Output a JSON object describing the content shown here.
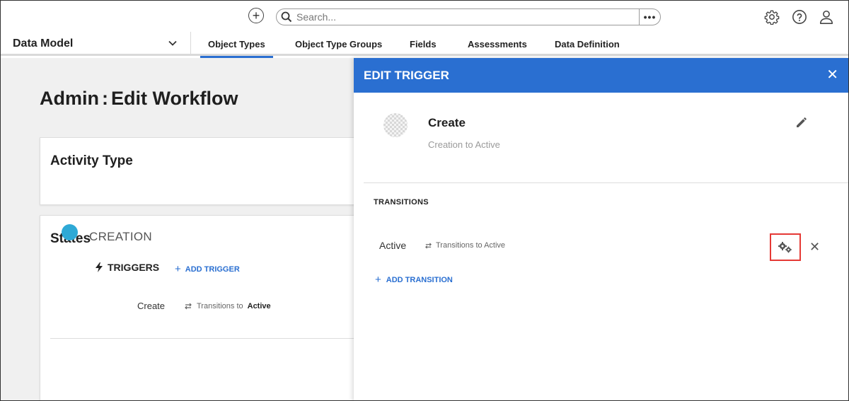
{
  "topbar": {
    "search_placeholder": "Search...",
    "icons": [
      "add-circle-icon",
      "search-icon",
      "more-icon",
      "gear-icon",
      "help-icon",
      "user-icon"
    ]
  },
  "nav": {
    "module": "Data Model",
    "tabs": [
      {
        "label": "Object Types",
        "active": true
      },
      {
        "label": "Object Type Groups",
        "active": false
      },
      {
        "label": "Fields",
        "active": false
      },
      {
        "label": "Assessments",
        "active": false
      },
      {
        "label": "Data Definition",
        "active": false
      }
    ]
  },
  "page": {
    "title_prefix": "Admin",
    "title_sep": ":",
    "title_main": "Edit Workflow",
    "activity_card_title": "Activity Type",
    "states_card_title": "States",
    "state": {
      "name": "CREATION",
      "color": "#2ea9d6",
      "triggers_label": "TRIGGERS",
      "add_trigger_label": "ADD TRIGGER",
      "trigger": {
        "name": "Create",
        "transitions_prefix": "Transitions to",
        "transitions_target": "Active"
      }
    }
  },
  "panel": {
    "title": "EDIT TRIGGER",
    "trigger_name": "Create",
    "trigger_subtitle": "Creation to Active",
    "transitions_label": "TRANSITIONS",
    "transition": {
      "name": "Active",
      "description": "Transitions to Active"
    },
    "add_transition_label": "ADD TRANSITION",
    "accent_color": "#2a6fd1",
    "highlight_color": "#e53935"
  }
}
